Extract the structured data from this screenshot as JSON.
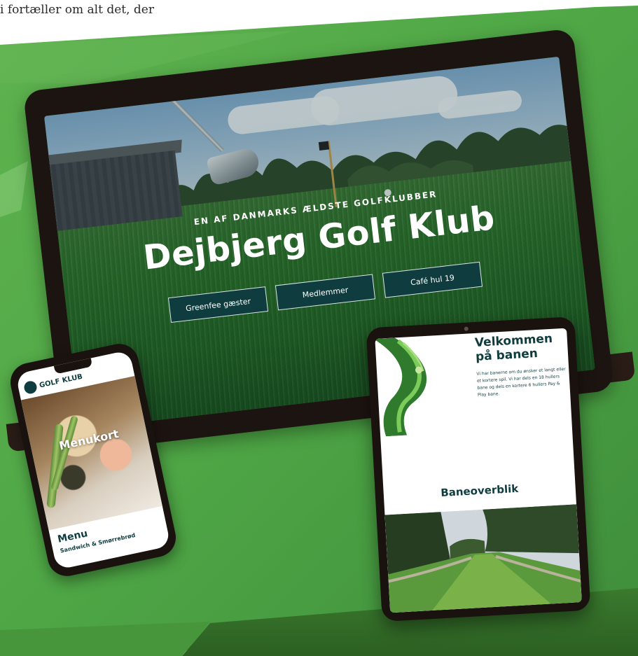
{
  "page": {
    "top_text": "i fortæller om alt det, der"
  },
  "laptop": {
    "hero_kicker": "EN AF DANMARKS ÆLDSTE GOLFKLUBBER",
    "hero_title": "Dejbjerg Golf Klub",
    "buttons": [
      "Greenfee gæster",
      "Medlemmer",
      "Café hul 19"
    ]
  },
  "phone": {
    "brand": "GOLF KLUB",
    "overlay_title": "Menukort",
    "menu_heading": "Menu",
    "menu_sub": "Sandwich & Smørrebrød"
  },
  "tablet": {
    "title": "Velkommen på banen",
    "intro": "Vi har banerne om du ønsker et langt eller et kortere spil. Vi har dels en 18 hullers bane og dels en kortere 6 hullers Pay & Play bane.",
    "overview_heading": "Baneoverblik"
  },
  "colors": {
    "brand_dark_green": "#0f3d3f",
    "poster_green": "#4fa845",
    "device_frame": "#1c1410"
  }
}
